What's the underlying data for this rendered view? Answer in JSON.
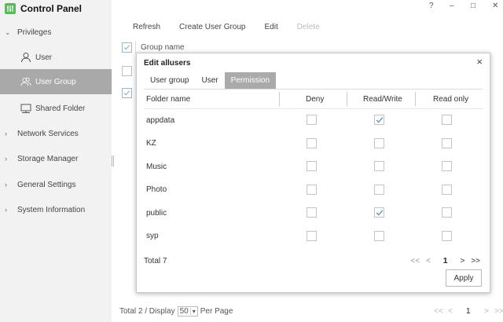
{
  "app": {
    "title": "Control Panel"
  },
  "window_controls": {
    "help": "?",
    "minimize": "–",
    "maximize": "□",
    "close": "✕"
  },
  "sidebar": {
    "items": [
      {
        "label": "Privileges",
        "expanded": true
      },
      {
        "label": "User"
      },
      {
        "label": "User Group",
        "active": true
      },
      {
        "label": "Shared Folder"
      },
      {
        "label": "Network Services"
      },
      {
        "label": "Storage Manager"
      },
      {
        "label": "General Settings"
      },
      {
        "label": "System Information"
      }
    ]
  },
  "toolbar": {
    "refresh": "Refresh",
    "create": "Create User Group",
    "edit": "Edit",
    "delete": "Delete"
  },
  "table": {
    "header": "Group name"
  },
  "footer": {
    "total": "Total 2 / Display",
    "per_page_value": "50",
    "per_page_label": "Per Page",
    "first": "<<",
    "prev": "<",
    "page": "1",
    "next": ">",
    "last": ">>"
  },
  "dialog": {
    "title": "Edit allusers",
    "close": "×",
    "tabs": [
      "User group",
      "User",
      "Permission"
    ],
    "active_tab": "Permission",
    "columns": {
      "folder": "Folder name",
      "deny": "Deny",
      "rw": "Read/Write",
      "ro": "Read only"
    },
    "rows": [
      {
        "name": "appdata",
        "deny": false,
        "rw": true,
        "ro": false
      },
      {
        "name": "KZ",
        "deny": false,
        "rw": false,
        "ro": false
      },
      {
        "name": "Music",
        "deny": false,
        "rw": false,
        "ro": false
      },
      {
        "name": "Photo",
        "deny": false,
        "rw": false,
        "ro": false
      },
      {
        "name": "public",
        "deny": false,
        "rw": true,
        "ro": false
      },
      {
        "name": "syp",
        "deny": false,
        "rw": false,
        "ro": false
      }
    ],
    "total": "Total 7",
    "pager": {
      "first": "<<",
      "prev": "<",
      "page": "1",
      "next": ">",
      "last": ">>"
    },
    "apply": "Apply"
  },
  "colors": {
    "accent_check": "#5b8fb9",
    "active_tab": "#aaaaaa",
    "sidebar_active": "#a9a9a9",
    "logo": "#5cb85c"
  }
}
